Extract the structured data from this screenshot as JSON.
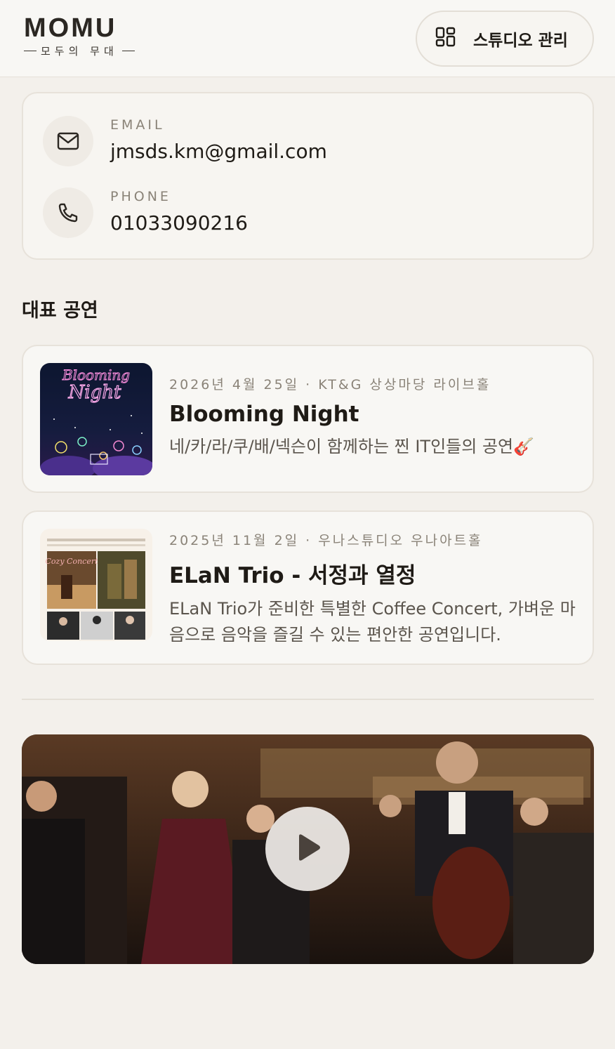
{
  "header": {
    "logo": "MOMU",
    "logo_sub": "모두의 무대",
    "studio_button": {
      "icon": "grid-icon",
      "label": "스튜디오 관리"
    }
  },
  "contact": {
    "email": {
      "icon": "mail-icon",
      "label": "EMAIL",
      "value": "jmsds.km@gmail.com"
    },
    "phone": {
      "icon": "phone-icon",
      "label": "PHONE",
      "value": "01033090216"
    }
  },
  "performances_section": {
    "title": "대표 공연",
    "items": [
      {
        "meta": "2026년 4월 25일 · KT&G 상상마당 라이브홀",
        "title": "Blooming Night",
        "description": "네/카/라/쿠/배/넥슨이 함께하는 찐 IT인들의 공연🎸",
        "poster_text": "Blooming Night"
      },
      {
        "meta": "2025년 11월 2일 · 우나스튜디오 우나아트홀",
        "title": "ELaN Trio - 서정과 열정",
        "description": "ELaN Trio가 준비한 특별한 Coffee Concert, 가벼운 마음으로 음악을 즐길 수 있는 편안한 공연입니다.",
        "poster_text": "Cozy Concert"
      }
    ]
  },
  "video": {
    "play_icon": "play-icon"
  },
  "colors": {
    "background": "#f3f0eb",
    "card": "#f8f7f4",
    "accent_text": "#1f1b16",
    "muted": "#8a8378"
  }
}
